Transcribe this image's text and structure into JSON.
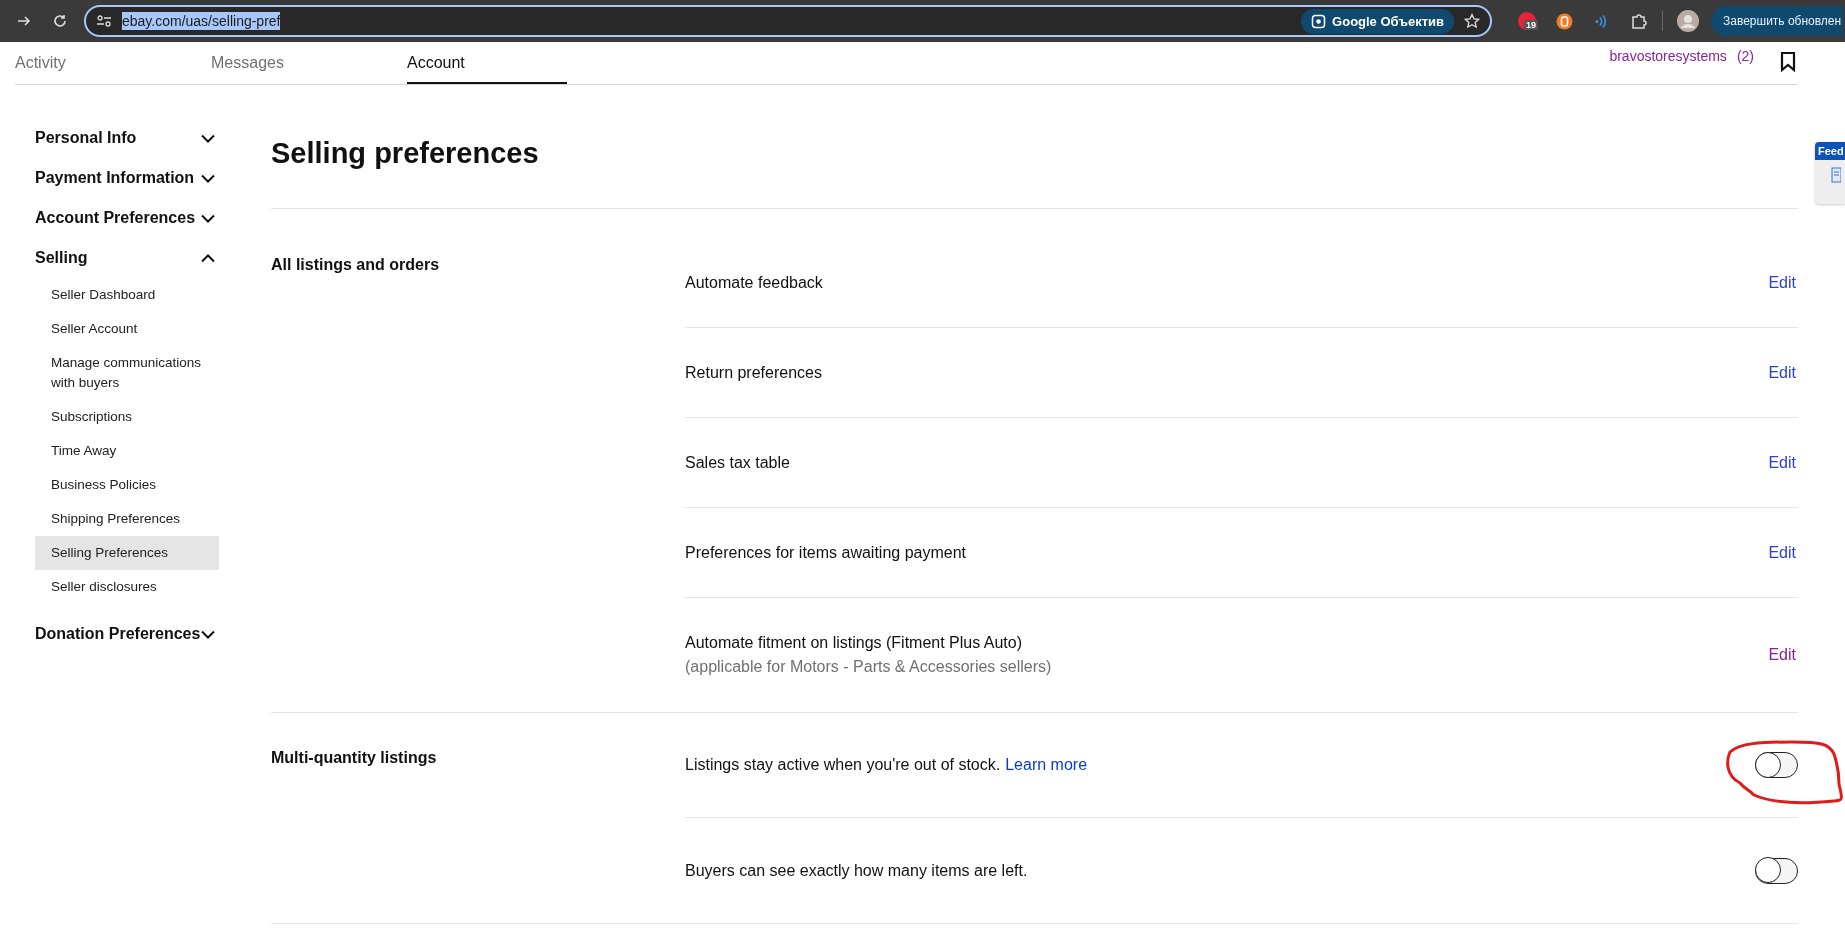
{
  "browser": {
    "url": "ebay.com/uas/selling-pref",
    "lens_button": "Google Объектив",
    "extension_badge": "19",
    "update_button": "Завершить обновлен"
  },
  "tabs": [
    {
      "label": "Activity",
      "selected": false
    },
    {
      "label": "Messages",
      "selected": false
    },
    {
      "label": "Account",
      "selected": true
    }
  ],
  "user": {
    "name": "bravostoresystems",
    "count": "(2)"
  },
  "sidebar": [
    {
      "label": "Personal Info",
      "expanded": false
    },
    {
      "label": "Payment Information",
      "expanded": false
    },
    {
      "label": "Account Preferences",
      "expanded": false
    },
    {
      "label": "Selling",
      "expanded": true,
      "children": [
        {
          "label": "Seller Dashboard",
          "selected": false
        },
        {
          "label": "Seller Account",
          "selected": false
        },
        {
          "label": "Manage communications with buyers",
          "selected": false
        },
        {
          "label": "Subscriptions",
          "selected": false
        },
        {
          "label": "Time Away",
          "selected": false
        },
        {
          "label": "Business Policies",
          "selected": false
        },
        {
          "label": "Shipping Preferences",
          "selected": false
        },
        {
          "label": "Selling Preferences",
          "selected": true
        },
        {
          "label": "Seller disclosures",
          "selected": false
        }
      ]
    },
    {
      "label": "Donation Preferences",
      "expanded": false
    }
  ],
  "page_title": "Selling preferences",
  "sections": [
    {
      "title": "All listings and orders",
      "rows": [
        {
          "kind": "link",
          "label": "Automate feedback",
          "action": "Edit",
          "visited": false
        },
        {
          "kind": "link",
          "label": "Return preferences",
          "action": "Edit",
          "visited": false
        },
        {
          "kind": "link",
          "label": "Sales tax table",
          "action": "Edit",
          "visited": false
        },
        {
          "kind": "link",
          "label": "Preferences for items awaiting payment",
          "action": "Edit",
          "visited": false
        },
        {
          "kind": "link",
          "label": "Automate fitment on listings (Fitment Plus Auto)",
          "note": "(applicable for Motors - Parts & Accessories sellers)",
          "action": "Edit",
          "visited": true
        }
      ]
    },
    {
      "title": "Multi-quantity listings",
      "rows": [
        {
          "kind": "toggle",
          "label": "Listings stay active when you're out of stock.",
          "link": "Learn more",
          "on": false
        },
        {
          "kind": "toggle",
          "label": "Buyers can see exactly how many items are left.",
          "on": false
        }
      ]
    }
  ],
  "feedback_tab": {
    "label": "Feed"
  }
}
